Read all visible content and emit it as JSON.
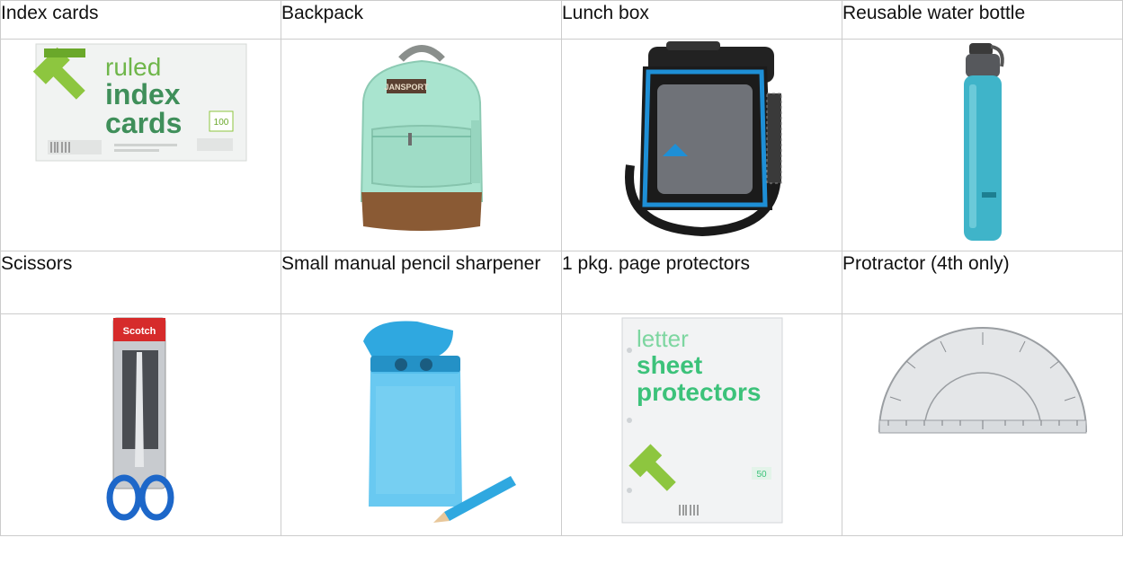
{
  "rows": [
    {
      "labels": [
        "Index cards",
        "Backpack",
        "Lunch box",
        "Reusable water bottle"
      ]
    },
    {
      "labels": [
        "Scissors",
        "Small manual pencil sharpener",
        "1 pkg. page protectors",
        "Protractor (4th only)"
      ]
    }
  ],
  "products": {
    "index_cards": {
      "line1": "ruled",
      "line2": "index",
      "line3": "cards",
      "badge": "100"
    },
    "sheet_protectors": {
      "line1": "letter",
      "line2": "sheet",
      "line3": "protectors",
      "count": "50"
    },
    "backpack": {
      "brand": "JANSPORT"
    },
    "scissors": {
      "brand": "Scotch"
    }
  },
  "colors": {
    "upup_green": "#8dc63f",
    "backpack_mint": "#a9e4cf",
    "backpack_bottom": "#8a5a34",
    "lunchbox_blue": "#1e8fd6",
    "bottle_teal": "#3fb4c9",
    "sharpener_blue": "#2fa8e0",
    "scissors_red": "#d62b2b",
    "handle_blue": "#1d67c9"
  }
}
